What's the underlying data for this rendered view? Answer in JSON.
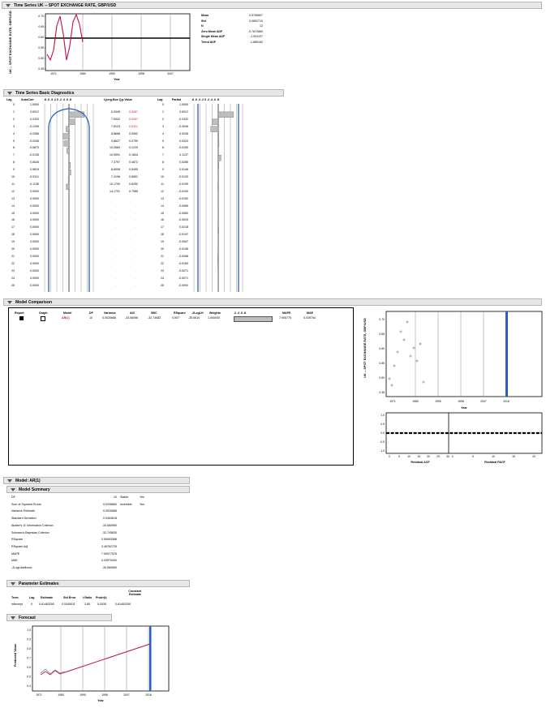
{
  "title_bar": "Time Series UK -- SPOT EXCHANGE RATE, GBP/USD",
  "ts_plot": {
    "ylabel": "UK -- SPOT EXCHANGE RATE, GBP/USD",
    "xlabel": "Year",
    "yticks": [
      "0.70",
      "0.65",
      "0.60",
      "0.55",
      "0.50",
      "0.45"
    ],
    "xticks": [
      "1971",
      "1980",
      "1990",
      "1998",
      "2007"
    ],
    "line_color": "#c0143c"
  },
  "stats": [
    {
      "label": "Mean",
      "value": "0.5756807"
    },
    {
      "label": "Std",
      "value": "0.0652710"
    },
    {
      "label": "N",
      "value": "12"
    },
    {
      "label": "Zero Mean ADF",
      "value": "-0.7672660"
    },
    {
      "label": "Single Mean ADF",
      "value": "-1.091107"
    },
    {
      "label": "Trend ADF",
      "value": "-1.685162"
    }
  ],
  "diagnostics": {
    "header": "Time Series Basic Diagnostics",
    "acf_cols": [
      "Lag",
      "AutoCorr",
      ".8 .6 .4 .2 0 .2 .4 .6 .8",
      "Ljung-Box Q",
      "p-Value"
    ],
    "pacf_cols": [
      "Lag",
      "Partial",
      ".8 .6 .4 .2 0 .2 .4 .6 .8"
    ],
    "lags": [
      "0",
      "1",
      "2",
      "3",
      "4",
      "5",
      "6",
      "7",
      "8",
      "9",
      "10",
      "11",
      "12",
      "13",
      "14",
      "15",
      "16",
      "17",
      "18",
      "19",
      "20",
      "21",
      "22",
      "23",
      "24",
      "25"
    ],
    "autocorr": [
      "1.0000",
      "0.6312",
      "0.2433",
      "-0.1206",
      "-0.2356",
      "-0.2046",
      "-0.0870",
      "-0.0135",
      "0.0626",
      "0.0819",
      "-0.0311",
      "-0.1136",
      "0.0000",
      "0.0000",
      "0.0000",
      "0.0000",
      "0.0000",
      "0.0000",
      "0.0000",
      "0.0000",
      "0.0000",
      "0.0000",
      "0.0000",
      "0.0000",
      "0.0000",
      "0.0000"
    ],
    "ljung": [
      "",
      "6.5345",
      "7.5420",
      "7.8123",
      "8.8688",
      "9.8627",
      "10.0583",
      "10.0591",
      "7.3797",
      "8.8008",
      "7.4196",
      "10.1790",
      "14.1791"
    ],
    "pvalue": [
      "",
      "0.0067",
      "0.0267",
      "0.0421",
      "0.0592",
      "0.0790",
      "0.1225",
      "0.1844",
      "0.4872",
      "0.5495",
      "0.5651",
      "0.6252",
      "0.7985"
    ],
    "partial": [
      "1.0000",
      "0.6312",
      "-0.2432",
      "-0.3046",
      "0.0236",
      "0.0323",
      "-0.0150",
      "0.1137",
      "0.0285",
      "0.0146",
      "-0.0120",
      "-0.0199",
      "-0.0100",
      "-0.0152",
      "-0.0089",
      "-0.0060",
      "-0.0025",
      "0.0218",
      "-0.0107",
      "-0.0067",
      "-0.0146",
      "-0.0268",
      "-0.0183",
      "-0.0071",
      "-0.0071",
      "-0.0092"
    ]
  },
  "model_comparison": {
    "header": "Model Comparison",
    "cols": [
      "Report",
      "Graph",
      "Model",
      "DF",
      "Variance",
      "AIC",
      "SBC",
      "RSquare",
      "-2LogLH",
      "Weights",
      ".2 .4 .6 .8",
      "MAPE",
      "MAE"
    ],
    "row": {
      "model": "AR(1)",
      "df": "10",
      "variance": "0.0020686",
      "aic": "-33.56096",
      "sbc": "-32.74583",
      "rsquare": "0.507",
      "loglh": "-35.5610",
      "weights": "1.000000",
      "mape": "7.905775",
      "mae": "0.039754"
    },
    "plot_ylabel": "UK -- SPOT EXCHANGE RATE, GBP/USD",
    "plot_xlabel": "Year",
    "plot_yticks": [
      "0.70",
      "0.65",
      "0.60",
      "0.55",
      "0.50",
      "0.45"
    ],
    "plot_xticks": [
      "1971",
      "1980",
      "1990",
      "1998",
      "2007",
      "2016"
    ],
    "resid_left_ticks": [
      "1.0",
      "0.5",
      "0.0",
      "-0.5",
      "-1.0"
    ],
    "resid_right_ticks": [
      "1.0",
      "0.5",
      "0.0",
      "-0.5",
      "-1.0"
    ],
    "resid_xticks_left": [
      "0",
      "5",
      "10",
      "15",
      "20",
      "25",
      "30"
    ],
    "resid_xticks_right": [
      "0",
      "5",
      "10",
      "15",
      "20"
    ],
    "resid_xlabel_left": "Residual ACF",
    "resid_xlabel_right": "Residual PACF"
  },
  "model_ar": {
    "header": "Model: AR(1)",
    "summary_header": "Model Summary",
    "summary": [
      {
        "label": "DF",
        "value": "10"
      },
      {
        "label": "Sum of Squared Errors",
        "value": "0.0206860"
      },
      {
        "label": "Variance Estimate",
        "value": "0.0020686"
      },
      {
        "label": "Standard Deviation",
        "value": "0.0454818"
      },
      {
        "label": "Akaike's 'A' Information Criterion",
        "value": "-33.560960"
      },
      {
        "label": "Schwarz's Bayesian Criterion",
        "value": "-32.745830"
      },
      {
        "label": "RSquare",
        "value": "0.50693386"
      },
      {
        "label": "RSquare Adj",
        "value": "0.45762725"
      },
      {
        "label": "MAPE",
        "value": "7.90577576"
      },
      {
        "label": "MAE",
        "value": "0.03975400"
      },
      {
        "label": "-2LogLikelihood",
        "value": "-35.560960"
      }
    ],
    "stable_label": "Stable",
    "stable_value": "Yes",
    "invertible_label": "Invertible",
    "invertible_value": "Yes",
    "param_header": "Parameter Estimates",
    "param_cols": [
      "Term",
      "Lag",
      "Estimate",
      "Std Error",
      "t Ratio",
      "Prob>|t|",
      "Constant Estimate"
    ],
    "param_row": {
      "term": "Intercept",
      "lag": "0",
      "estimate": "0.61463250",
      "stderr": "0.0345011",
      "tratio": "3.80",
      "prob": "0.0035",
      "const": "0.61463250"
    },
    "forecast_header": "Forecast",
    "forecast_ylabel": "Predicted Value",
    "forecast_xlabel": "Year",
    "forecast_yticks": [
      "1.0",
      "0.9",
      "0.8",
      "0.7",
      "0.6",
      "0.5",
      "0.4"
    ],
    "forecast_xticks": [
      "1971",
      "1980",
      "1990",
      "1998",
      "2007",
      "2016"
    ]
  }
}
